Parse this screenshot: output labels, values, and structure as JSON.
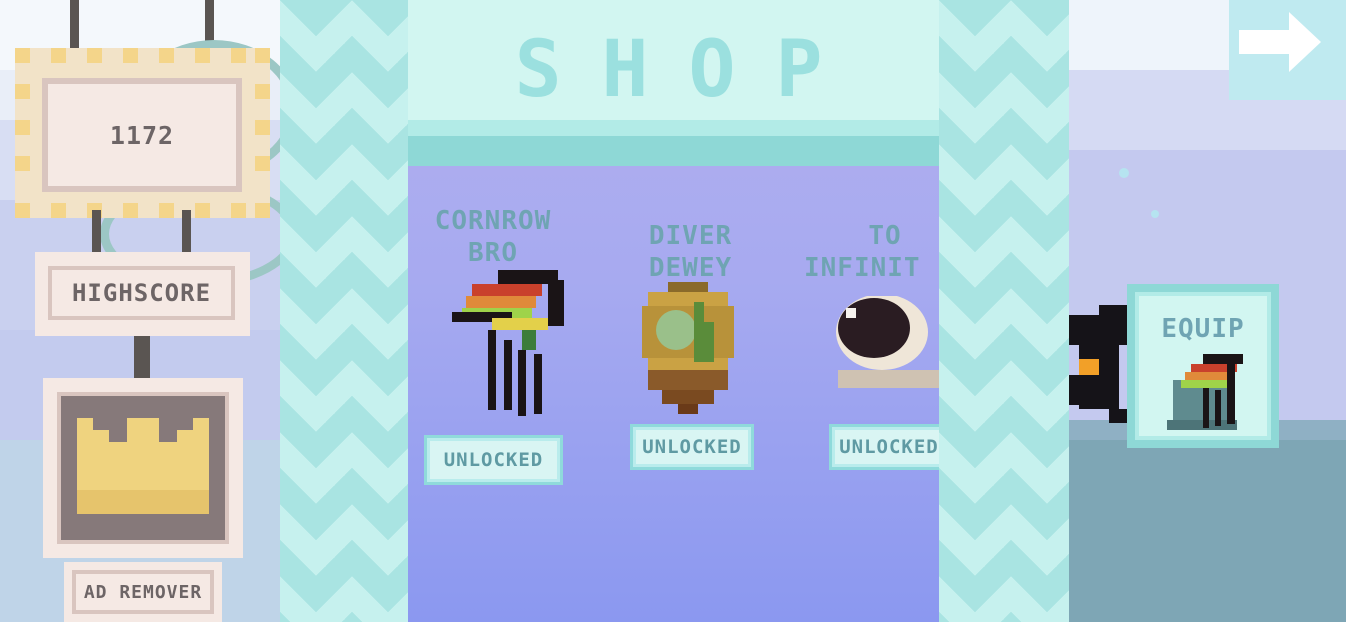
{
  "left_panel": {
    "score": "1172",
    "highscore_label": "HIGHSCORE",
    "ad_remover_label": "AD REMOVER"
  },
  "shop": {
    "title": "SHOP",
    "items": [
      {
        "name_line1": "CORNROW",
        "name_line2": "BRO",
        "status": "UNLOCKED"
      },
      {
        "name_line1": "DIVER",
        "name_line2": "DEWEY",
        "status": "UNLOCKED"
      },
      {
        "name_line1": "TO",
        "name_line2": "INFINIT",
        "status": "UNLOCKED"
      }
    ]
  },
  "right_panel": {
    "equip_label": "EQUIP"
  },
  "icons": [
    "crown-icon",
    "cornrow-hat-icon",
    "diving-helmet-icon",
    "space-helmet-icon",
    "character-icon",
    "next-arrow-icon"
  ],
  "colors": {
    "panel_cream": "#f5e9e4",
    "panel_border": "#d9c5bf",
    "text_gray": "#6d6566",
    "teal_text": "#6fa4b3",
    "shop_bg": "#a7aaf0",
    "zigzag_light": "#c6f1ee"
  }
}
